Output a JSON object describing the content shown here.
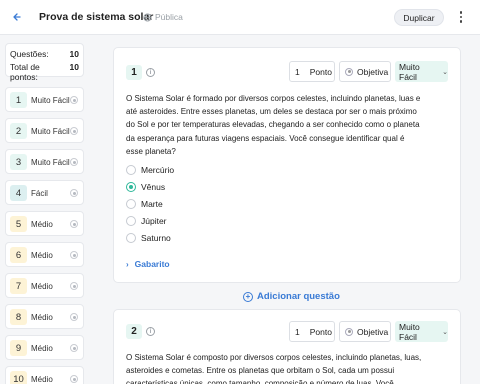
{
  "header": {
    "title": "Prova de sistema solar",
    "visibility": "Pública",
    "duplicate_label": "Duplicar",
    "icons": {
      "back": "arrow-left-icon",
      "visibility": "globe-icon",
      "menu": "more-vertical-icon"
    }
  },
  "summary": {
    "questions_label": "Questões:",
    "questions_value": "10",
    "points_label": "Total de pontos:",
    "points_value": "10"
  },
  "sidebar": {
    "items": [
      {
        "num": "1",
        "difficulty": "Muito Fácil",
        "color": "#e6f6f2"
      },
      {
        "num": "2",
        "difficulty": "Muito Fácil",
        "color": "#e6f6f2"
      },
      {
        "num": "3",
        "difficulty": "Muito Fácil",
        "color": "#e6f6f2"
      },
      {
        "num": "4",
        "difficulty": "Fácil",
        "color": "#dceff0"
      },
      {
        "num": "5",
        "difficulty": "Médio",
        "color": "#fdf3d6"
      },
      {
        "num": "6",
        "difficulty": "Médio",
        "color": "#fdf3d6"
      },
      {
        "num": "7",
        "difficulty": "Médio",
        "color": "#fdf3d6"
      },
      {
        "num": "8",
        "difficulty": "Médio",
        "color": "#fdf3d6"
      },
      {
        "num": "9",
        "difficulty": "Médio",
        "color": "#fdf3d6"
      },
      {
        "num": "10",
        "difficulty": "Médio",
        "color": "#fdf3d6"
      }
    ]
  },
  "questions": [
    {
      "num": "1",
      "points_value": "1",
      "points_label": "Ponto",
      "type": "Objetiva",
      "difficulty": "Muito Fácil",
      "text": "O Sistema Solar é formado por diversos corpos celestes, incluindo planetas, luas e até asteroides. Entre esses planetas, um deles se destaca por ser o mais próximo do Sol e por ter temperaturas elevadas, chegando a ser conhecido como o planeta da esperança para futuras viagens espaciais. Você consegue identificar qual é esse planeta?",
      "options": [
        {
          "label": "Mercúrio",
          "selected": false
        },
        {
          "label": "Vênus",
          "selected": true
        },
        {
          "label": "Marte",
          "selected": false
        },
        {
          "label": "Júpiter",
          "selected": false
        },
        {
          "label": "Saturno",
          "selected": false
        }
      ],
      "answer_key_label": "Gabarito"
    },
    {
      "num": "2",
      "points_value": "1",
      "points_label": "Ponto",
      "type": "Objetiva",
      "difficulty": "Muito Fácil",
      "text": "O Sistema Solar é composto por diversos corpos celestes, incluindo planetas, luas, asteroides e cometas. Entre os planetas que orbitam o Sol, cada um possui características únicas, como tamanho, composição e número de luas. Você"
    }
  ],
  "add_question_label": "Adicionar questão",
  "accent_color": "#3a7bd5",
  "selected_color": "#2fb89a"
}
